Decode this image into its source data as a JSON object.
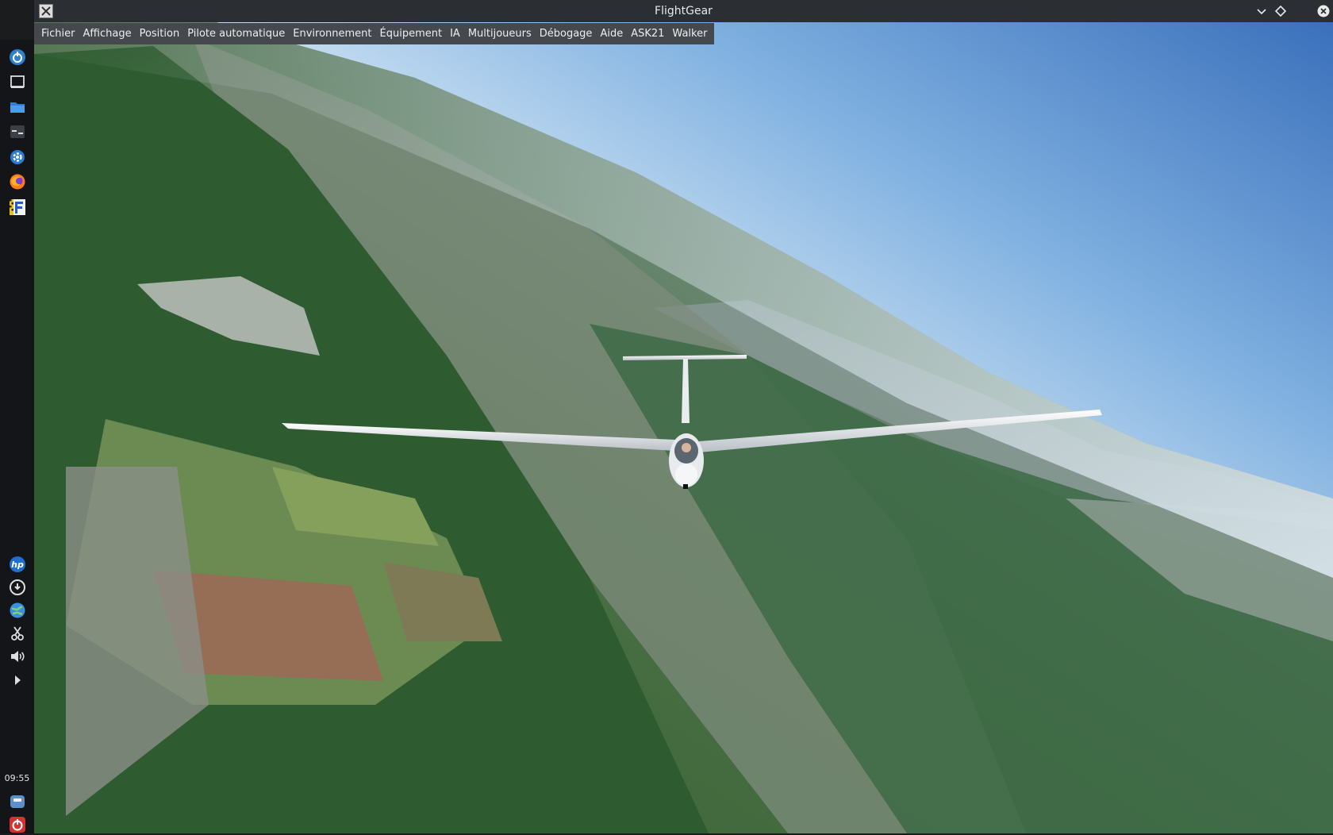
{
  "window": {
    "title": "FlightGear",
    "app_icon": "x11-app-icon",
    "controls": [
      "minimize",
      "maximize",
      "close"
    ]
  },
  "menubar": {
    "items": [
      {
        "label": "Fichier"
      },
      {
        "label": "Affichage"
      },
      {
        "label": "Position"
      },
      {
        "label": "Pilote automatique"
      },
      {
        "label": "Environnement"
      },
      {
        "label": "Équipement"
      },
      {
        "label": "IA"
      },
      {
        "label": "Multijoueurs"
      },
      {
        "label": "Débogage"
      },
      {
        "label": "Aide"
      },
      {
        "label": "ASK21"
      },
      {
        "label": "Walker"
      }
    ]
  },
  "dock": {
    "top_apps": [
      "app-menu-icon",
      "show-desktop-icon",
      "file-manager-icon",
      "terminal-icon",
      "settings-icon",
      "firefox-icon",
      "flightgear-icon"
    ],
    "tray": [
      "hp-icon",
      "update-icon",
      "network-icon",
      "screenshot-scissors-icon",
      "volume-icon",
      "expand-arrow-icon"
    ],
    "clock": "09:55",
    "bottom": [
      "removable-drive-icon",
      "power-icon"
    ]
  },
  "scene": {
    "description_hidden": true,
    "colors": {
      "sky_top": "#3f78bf",
      "sky_haze": "#d8e8f4",
      "forest": "#2c5a32",
      "meadow": "#6e8f4c"
    }
  }
}
